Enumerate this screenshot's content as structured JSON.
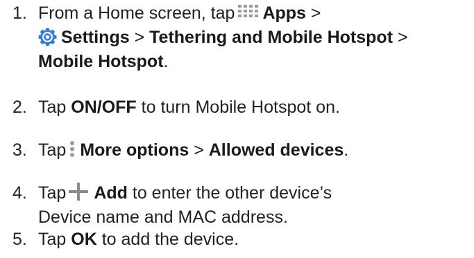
{
  "steps": [
    {
      "number": "1.",
      "line1_pre": "From a Home screen, tap",
      "line1_bold": "Apps",
      "line1_post": " >",
      "line2_bold": "Settings",
      "line2_sep": " > ",
      "line2_bold2": "Tethering and Mobile Hotspot",
      "line2_post": " >",
      "line3_bold": "Mobile Hotspot",
      "line3_post": "."
    },
    {
      "number": "2.",
      "pre": "Tap ",
      "bold": "ON/OFF",
      "post": " to turn Mobile Hotspot on."
    },
    {
      "number": "3.",
      "pre": "Tap",
      "bold": "More options",
      "sep": " > ",
      "bold2": "Allowed devices",
      "post": "."
    },
    {
      "number": "4.",
      "pre": "Tap",
      "bold": "Add",
      "post": " to enter the other device’s",
      "line2": "Device name and MAC address."
    },
    {
      "number": "5.",
      "pre": "Tap ",
      "bold": "OK",
      "post": " to add the device."
    }
  ],
  "icons": {
    "apps": "apps-grid-icon",
    "settings": "settings-gear-icon",
    "more": "more-options-icon",
    "add": "add-plus-icon"
  },
  "colors": {
    "text": "#222222",
    "icon_gray": "#8a8a8a",
    "settings_blue": "#2f7fd8"
  }
}
